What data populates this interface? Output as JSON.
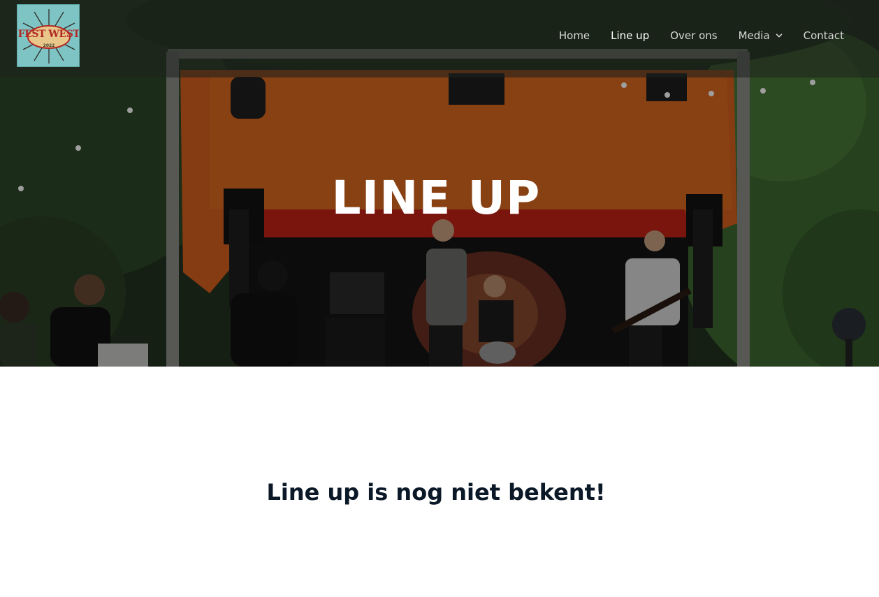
{
  "header": {
    "logo": {
      "text": "FEST WEST",
      "year": "2022",
      "background": "#7fc4c4",
      "text_color": "#b22a25"
    },
    "nav": {
      "items": [
        {
          "label": "Home",
          "active": false
        },
        {
          "label": "Line up",
          "active": true
        },
        {
          "label": "Over ons",
          "active": false
        },
        {
          "label": "Media",
          "active": false,
          "has_dropdown": true,
          "icon": "chevron-down-icon"
        },
        {
          "label": "Contact",
          "active": false
        }
      ]
    }
  },
  "hero": {
    "title": "LINE UP"
  },
  "main": {
    "heading": "Line up is nog niet bekent!"
  },
  "colors": {
    "nav_text": "#d5d8d5",
    "nav_active": "#ffffff",
    "heading": "#0b1827",
    "stage_canopy": "#d8611d"
  }
}
